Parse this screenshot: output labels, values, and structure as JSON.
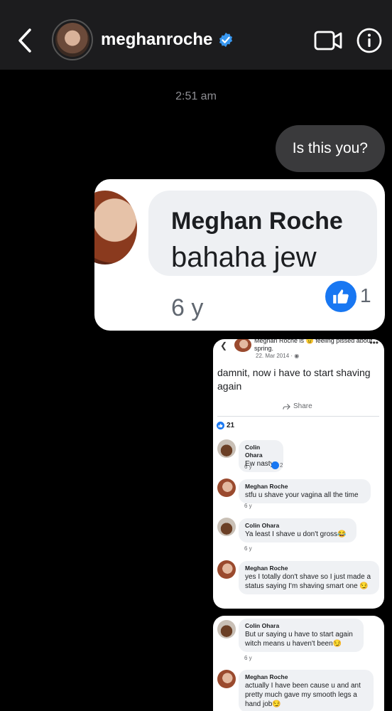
{
  "header": {
    "username": "meghanroche",
    "icons": [
      "back-chevron-icon",
      "verified-badge-icon",
      "video-call-icon",
      "info-icon"
    ]
  },
  "thread": {
    "timestamp": "2:51 am",
    "outgoing_message": "Is this you?"
  },
  "shared_image_1": {
    "commenter_name": "Meghan Roche",
    "comment_text": "bahaha jew",
    "age": "6 y",
    "like_count": "1"
  },
  "shared_image_2": {
    "post_author_line": "Meghan Roche is 😠 feeling pissed about spring.",
    "post_date": "22. Mar 2014 ·",
    "post_text": "damnit, now i have to start shaving again",
    "share_label": "Share",
    "reaction_count": "21",
    "comments": [
      {
        "name": "Colin Ohara",
        "text": "Ew nasty",
        "time": "6 y",
        "likes": "2"
      },
      {
        "name": "Meghan Roche",
        "text": "stfu u shave your vagina all the time",
        "time": "6 y"
      },
      {
        "name": "Colin Ohara",
        "text": "Ya least I shave u don't gross😂",
        "time": "6 y"
      },
      {
        "name": "Meghan Roche",
        "text": "yes I totally don't shave so I just made a status saying I'm shaving smart one 😏"
      }
    ]
  },
  "shared_image_3": {
    "comments": [
      {
        "name": "Colin Ohara",
        "text": "But ur saying u have to start again witch means u haven't been😏",
        "time": "6 y"
      },
      {
        "name": "Meghan Roche",
        "text": "actually I have been cause u and ant pretty much gave my smooth legs a hand job😏"
      }
    ]
  },
  "colors": {
    "background": "#000000",
    "header": "#1c1c1e",
    "outgoing_bubble": "#3a3a3c",
    "verified_blue": "#3897f0",
    "fb_blue": "#1877f2"
  }
}
